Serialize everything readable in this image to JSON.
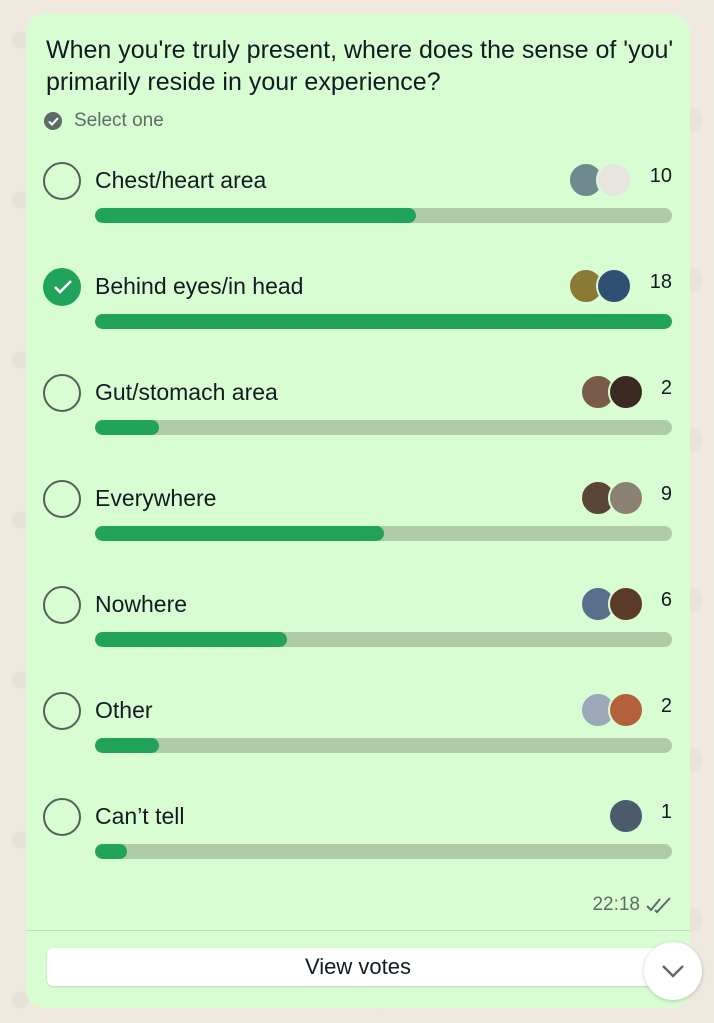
{
  "poll": {
    "question": "When you're truly present, where does the sense of 'you' primarily reside in your experience?",
    "select_hint": "Select one",
    "options": [
      {
        "label": "Chest/heart area",
        "count": "10",
        "fraction": 0.556,
        "checked": false,
        "avatar_colors": [
          "#6f8a8f",
          "#e8e4df"
        ]
      },
      {
        "label": "Behind eyes/in head",
        "count": "18",
        "fraction": 1.0,
        "checked": true,
        "avatar_colors": [
          "#8a7a35",
          "#2f4f73"
        ]
      },
      {
        "label": "Gut/stomach area",
        "count": "2",
        "fraction": 0.111,
        "checked": false,
        "avatar_colors": [
          "#7a5a4a",
          "#3a2a22"
        ]
      },
      {
        "label": "Everywhere",
        "count": "9",
        "fraction": 0.5,
        "checked": false,
        "avatar_colors": [
          "#5a4538",
          "#8b8074"
        ]
      },
      {
        "label": "Nowhere",
        "count": "6",
        "fraction": 0.333,
        "checked": false,
        "avatar_colors": [
          "#5a6f8c",
          "#5b3a2a"
        ]
      },
      {
        "label": "Other",
        "count": "2",
        "fraction": 0.111,
        "checked": false,
        "avatar_colors": [
          "#9aa8b8",
          "#b5603d"
        ]
      },
      {
        "label": "Can’t tell",
        "count": "1",
        "fraction": 0.056,
        "checked": false,
        "avatar_colors": [
          "#4c5a6a"
        ]
      }
    ],
    "timestamp": "22:18",
    "view_votes_label": "View votes"
  },
  "colors": {
    "accent": "#21a35c",
    "bubble": "#d9fdd3",
    "bar_track": "#b0cba7"
  },
  "icons": {
    "select_hint": "check-circle-icon",
    "read_receipt": "double-check-icon",
    "scroll": "chevron-down-icon"
  }
}
